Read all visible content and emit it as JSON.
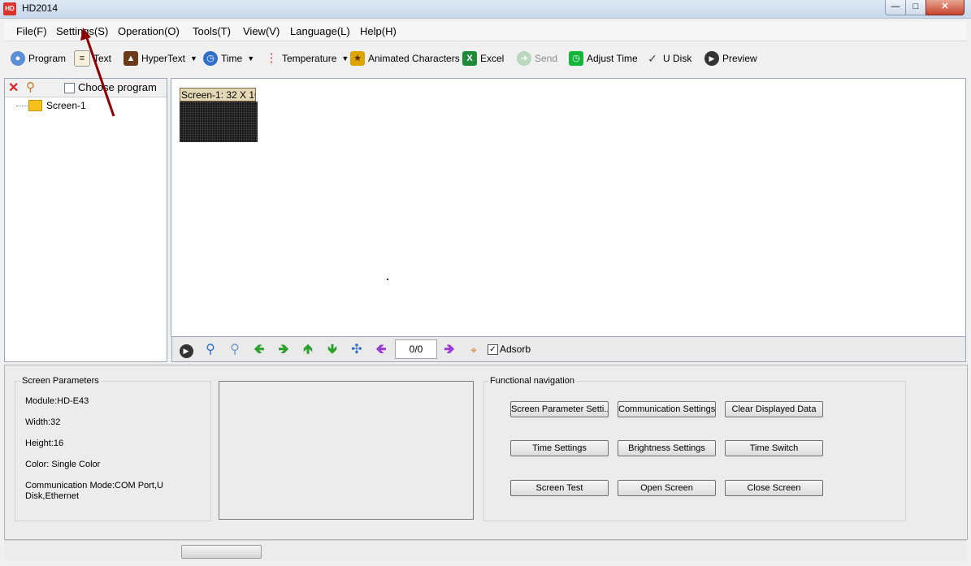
{
  "window": {
    "title": "HD2014",
    "app_icon": "HD"
  },
  "menu": [
    "File(F)",
    "Settings(S)",
    "Operation(O)",
    "Tools(T)",
    "View(V)",
    "Language(L)",
    "Help(H)"
  ],
  "toolbar": {
    "program": "Program",
    "text": "Text",
    "hypertext": "HyperText",
    "time": "Time",
    "temperature": "Temperature",
    "animated": "Animated Characters",
    "excel": "Excel",
    "send": "Send",
    "adjust_time": "Adjust Time",
    "udisk": "U Disk",
    "preview": "Preview"
  },
  "tree": {
    "choose_program": "Choose program",
    "screen_item": "Screen-1"
  },
  "canvas": {
    "screen_label": "Screen-1: 32 X 16"
  },
  "nav": {
    "page_counter": "0/0",
    "adsorb": "Adsorb",
    "adsorb_checked": true
  },
  "params": {
    "title": "Screen Parameters",
    "module": "Module:HD-E43",
    "width": "Width:32",
    "height": "Height:16",
    "color": "Color: Single Color",
    "comm_mode": "Communication Mode:COM Port,U Disk,Ethernet"
  },
  "functional": {
    "title": "Functional navigation",
    "buttons": [
      "Screen Parameter Setti...",
      "Communication Settings",
      "Clear Displayed Data",
      "Time Settings",
      "Brightness Settings",
      "Time Switch",
      "Screen Test",
      "Open Screen",
      "Close Screen"
    ]
  },
  "annotation": {
    "arrow_color": "#8b0000"
  }
}
